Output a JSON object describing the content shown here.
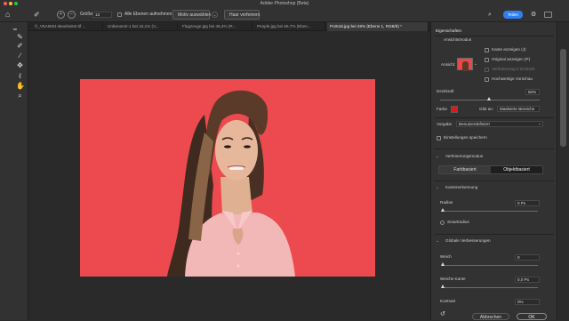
{
  "window": {
    "title": "Adobe Photoshop (Beta)"
  },
  "options_bar": {
    "size_label": "Größe:",
    "size_value": "13",
    "sample_all_layers_label": "Alle Ebenen aufnehmen",
    "select_subject_label": "Motiv auswählen",
    "refine_hair_label": "Haar verfeinern",
    "share_label": "Teilen"
  },
  "document_tabs": [
    {
      "label": "©_V6A6601-Bearbeitet.tif ..."
    },
    {
      "label": "Unbenannt-1 bei 16,1% (V..."
    },
    {
      "label": "Flugzeuge.jpg bei 46,4% (R..."
    },
    {
      "label": "People.jpg bei 66,7% (Eben..."
    },
    {
      "label": "Portrait.jpg bei 26% (Ebene 1, RGB/8) *"
    }
  ],
  "tools": [
    {
      "name": "brush-tool-icon",
      "glyph": "✎"
    },
    {
      "name": "quick-selection-icon",
      "glyph": "✐"
    },
    {
      "name": "brush-icon",
      "glyph": "∕"
    },
    {
      "name": "object-selection-icon",
      "glyph": "✥"
    },
    {
      "name": "lasso-icon",
      "glyph": "ℓ"
    },
    {
      "name": "hand-icon",
      "glyph": "✋"
    },
    {
      "name": "zoom-icon",
      "glyph": "⌕"
    }
  ],
  "panel": {
    "title": "Eigenschaften",
    "view_mode_section": "Ansichtsmodus",
    "view_label": "Ansicht:",
    "show_edge_label": "Kante anzeigen (J)",
    "show_original_label": "Original anzeigen (P)",
    "realtime_refine_label": "Verfeinerung in Echtzeit",
    "high_quality_preview_label": "Hochwertige Vorschau",
    "opacity_label": "Deckkraft",
    "opacity_value": "50%",
    "opacity_level": 0.5,
    "color_label": "Farbe",
    "color_value": "#e01818",
    "indicates_label": "Gibt an:",
    "indicates_value": "Maskierte Bereiche",
    "preset_label": "Vorgabe",
    "preset_value": "Benutzerdefiniert",
    "save_settings_label": "Einstellungen speichern",
    "refine_mode_section": "Verfeinerungsmodus",
    "color_aware_label": "Farbbasiert",
    "object_aware_label": "Objektbasiert",
    "edge_detection_section": "Kantenerkennung",
    "radius_label": "Radius",
    "radius_value": "0 Px",
    "smart_radius_label": "Smartradius",
    "global_refinements_section": "Globale Verbesserungen",
    "smooth_label": "Weich",
    "smooth_value": "0",
    "feather_label": "Weiche Kante",
    "feather_value": "0,0 Px",
    "contrast_label": "Kontrast",
    "contrast_value": "0%",
    "cancel_label": "Abbrechen",
    "ok_label": "OK"
  },
  "colors": {
    "image_background": "#ec4a4f",
    "share_button": "#2f7ff0",
    "active_toggle": "#1e1e1e"
  }
}
